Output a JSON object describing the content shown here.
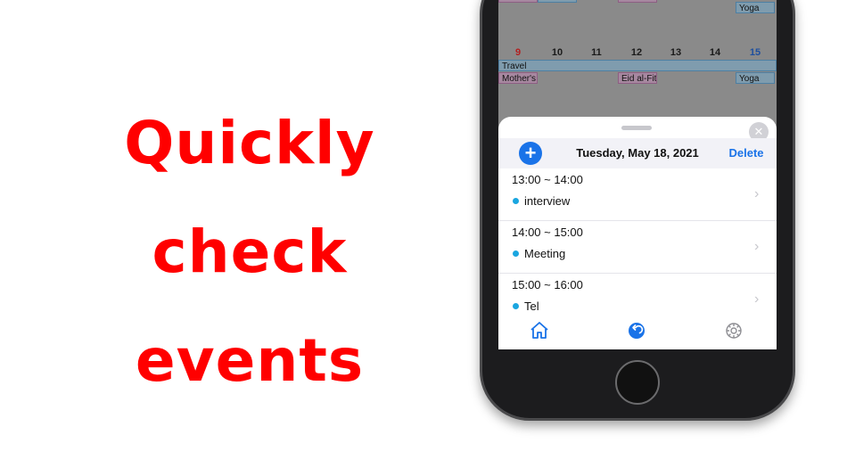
{
  "headline": {
    "line1": "Quickly",
    "line2": "check",
    "line3": "events"
  },
  "calendar": {
    "top_chip": "Yoga",
    "days": [
      "9",
      "10",
      "11",
      "12",
      "13",
      "14",
      "15"
    ],
    "events": {
      "travel": "Travel",
      "mother": "Mother's",
      "eid": "Eid al-Fit",
      "yoga": "Yoga"
    }
  },
  "sheet": {
    "close_icon": "close-icon",
    "add_icon": "plus-icon",
    "date_title": "Tuesday, May 18, 2021",
    "delete_label": "Delete",
    "events": [
      {
        "time": "13:00 ~ 14:00",
        "title": "interview"
      },
      {
        "time": "14:00 ~ 15:00",
        "title": "Meeting"
      },
      {
        "time": "15:00 ~ 16:00",
        "title": "Tel"
      }
    ]
  },
  "tabbar": {
    "items": [
      "home-icon",
      "back-icon",
      "gear-icon"
    ]
  },
  "colors": {
    "headline": "#ff0000",
    "accent": "#1a73e8",
    "event_dot": "#1aa6e0"
  }
}
